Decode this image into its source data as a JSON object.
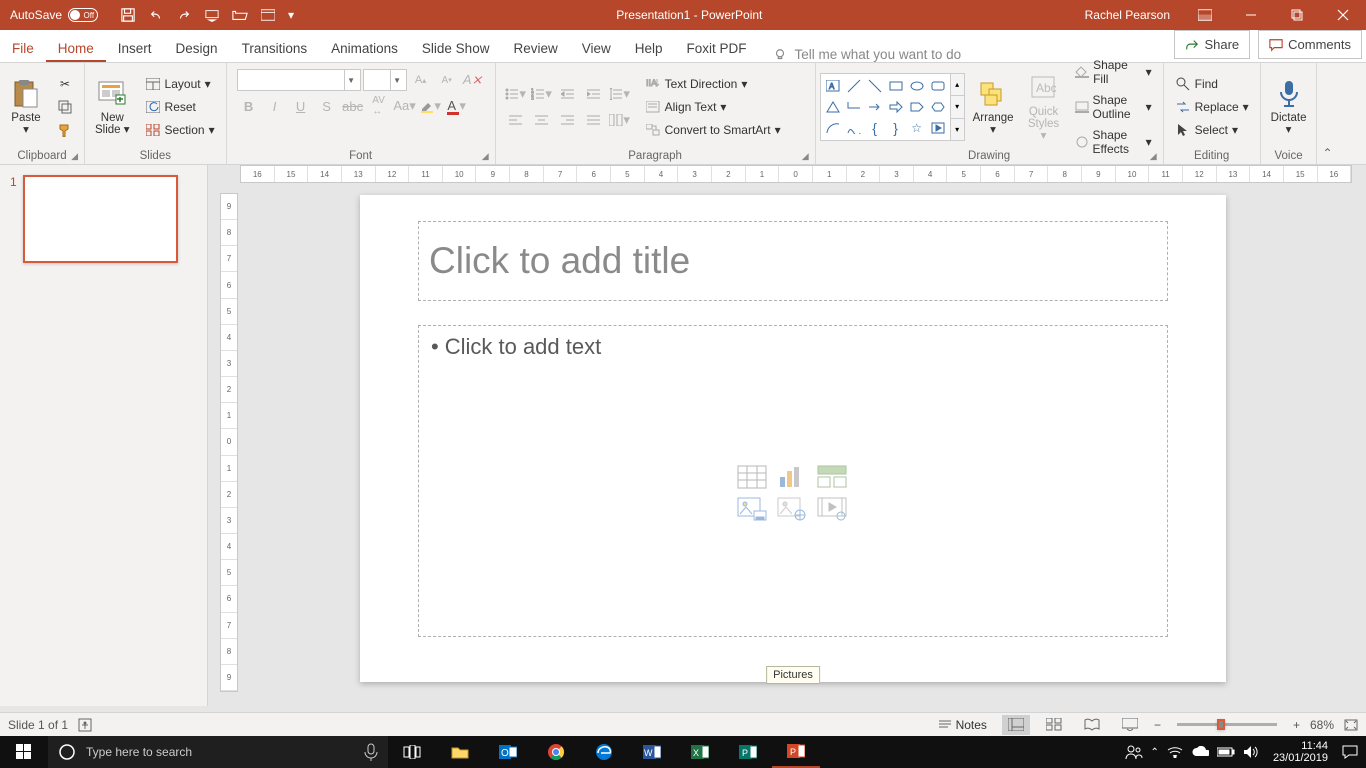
{
  "titlebar": {
    "autosave_label": "AutoSave",
    "autosave_state": "Off",
    "title": "Presentation1  -  PowerPoint",
    "user": "Rachel Pearson"
  },
  "ribbon": {
    "tabs": [
      "File",
      "Home",
      "Insert",
      "Design",
      "Transitions",
      "Animations",
      "Slide Show",
      "Review",
      "View",
      "Help",
      "Foxit PDF"
    ],
    "active_tab": "Home",
    "tellme": "Tell me what you want to do",
    "share": "Share",
    "comments": "Comments",
    "groups": {
      "clipboard": "Clipboard",
      "slides": "Slides",
      "font": "Font",
      "paragraph": "Paragraph",
      "drawing": "Drawing",
      "editing": "Editing",
      "voice": "Voice"
    },
    "clipboard": {
      "paste": "Paste"
    },
    "slides": {
      "new_slide": "New\nSlide",
      "layout": "Layout",
      "reset": "Reset",
      "section": "Section"
    },
    "font": {
      "name": "",
      "size": ""
    },
    "paragraph": {
      "text_direction": "Text Direction",
      "align_text": "Align Text",
      "convert": "Convert to SmartArt"
    },
    "drawing": {
      "arrange": "Arrange",
      "quick_styles": "Quick\nStyles",
      "shape_fill": "Shape Fill",
      "shape_outline": "Shape Outline",
      "shape_effects": "Shape Effects"
    },
    "editing": {
      "find": "Find",
      "replace": "Replace",
      "select": "Select"
    },
    "voice": {
      "dictate": "Dictate"
    }
  },
  "slide": {
    "number": "1",
    "title_placeholder": "Click to add title",
    "content_placeholder": "Click to add text",
    "tooltip": "Pictures"
  },
  "ruler_h": [
    "16",
    "15",
    "14",
    "13",
    "12",
    "11",
    "10",
    "9",
    "8",
    "7",
    "6",
    "5",
    "4",
    "3",
    "2",
    "1",
    "0",
    "1",
    "2",
    "3",
    "4",
    "5",
    "6",
    "7",
    "8",
    "9",
    "10",
    "11",
    "12",
    "13",
    "14",
    "15",
    "16"
  ],
  "ruler_v": [
    "9",
    "8",
    "7",
    "6",
    "5",
    "4",
    "3",
    "2",
    "1",
    "0",
    "1",
    "2",
    "3",
    "4",
    "5",
    "6",
    "7",
    "8",
    "9"
  ],
  "statusbar": {
    "slide_info": "Slide 1 of 1",
    "notes": "Notes",
    "zoom": "68%"
  },
  "taskbar": {
    "search_placeholder": "Type here to search",
    "time": "11:44",
    "date": "23/01/2019"
  }
}
